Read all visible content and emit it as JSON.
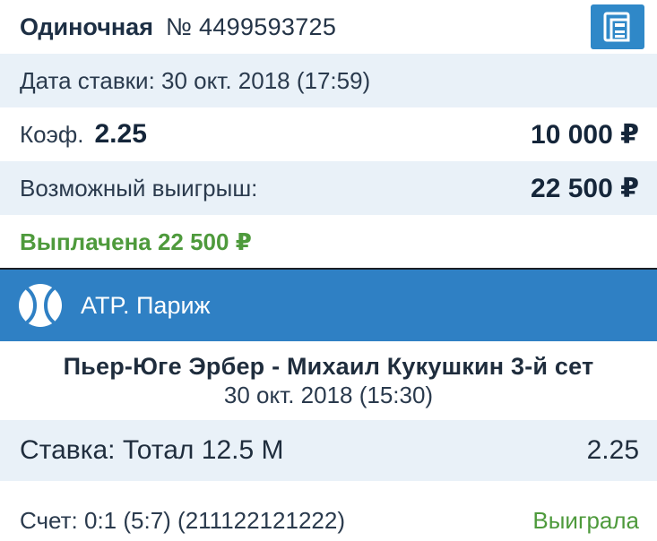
{
  "bet": {
    "type": "Одиночная",
    "number": "№ 4499593725",
    "date": "Дата ставки: 30 окт. 2018 (17:59)",
    "coef_label": "Коэф.",
    "coef_value": "2.25",
    "stake": "10 000 ₽",
    "possible_win_label": "Возможный выигрыш:",
    "possible_win_value": "22 500 ₽",
    "paid": "Выплачена 22 500 ₽"
  },
  "event": {
    "tournament": "ATP. Париж",
    "match": "Пьер-Юге Эрбер - Михаил Кукушкин 3-й сет",
    "date": "30 окт. 2018 (15:30)",
    "outcome": "Ставка: Тотал 12.5 М",
    "outcome_coef": "2.25",
    "score": "Счет: 0:1 (5:7) (211122121222)",
    "result": "Выиграла"
  },
  "icons": {
    "receipt": "receipt-icon",
    "sport": "tennis-ball-icon"
  },
  "colors": {
    "accent": "#2f80c4",
    "shade": "#e9f1f8",
    "success": "#4e9a3c",
    "text": "#1f2d3d"
  }
}
